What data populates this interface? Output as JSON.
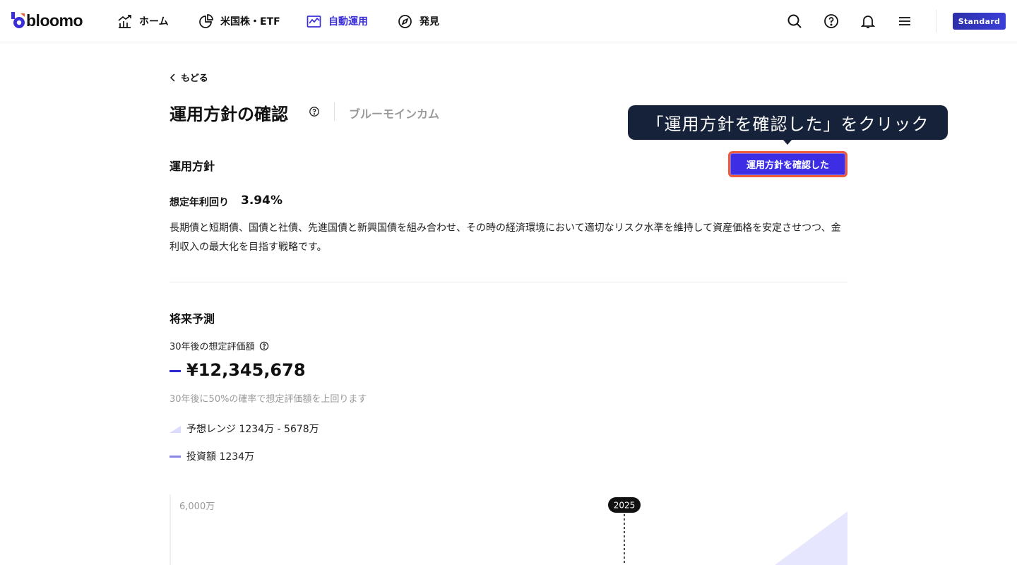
{
  "header": {
    "logo_text": "bloomo",
    "nav": [
      {
        "label": "ホーム",
        "icon": "chart-up-icon",
        "active": false
      },
      {
        "label": "米国株・ETF",
        "icon": "pie-chart-icon",
        "active": false
      },
      {
        "label": "自動運用",
        "icon": "line-chart-icon",
        "active": true
      },
      {
        "label": "発見",
        "icon": "compass-icon",
        "active": false
      }
    ],
    "icons": [
      "search-icon",
      "help-icon",
      "bell-icon",
      "menu-icon"
    ],
    "plan_badge": "Standard",
    "accent_color": "#3a2fd6"
  },
  "page": {
    "back_label": "もどる",
    "title": "運用方針の確認",
    "subtitle": "ブルーモインカム"
  },
  "tooltip": {
    "text": "「運用方針を確認した」をクリック"
  },
  "policy": {
    "heading": "運用方針",
    "confirm_button": "運用方針を確認した",
    "yield_label": "想定年利回り",
    "yield_value": "3.94%",
    "description": "長期債と短期債、国債と社債、先進国債と新興国債を組み合わせ、その時の経済環境において適切なリスク水準を維持して資産価格を安定させつつ、金利収入の最大化を目指す戦略です。"
  },
  "forecast": {
    "heading": "将来予測",
    "value_label": "30年後の想定評価額",
    "value": "¥12,345,678",
    "note": "30年後に50%の確率で想定評価額を上回ります",
    "range_legend": "予想レンジ 1234万 - 5678万",
    "invest_legend": "投資額 1234万"
  },
  "chart_data": {
    "type": "area",
    "ytick_labels": [
      "6,000万"
    ],
    "marker_label": "2025"
  }
}
